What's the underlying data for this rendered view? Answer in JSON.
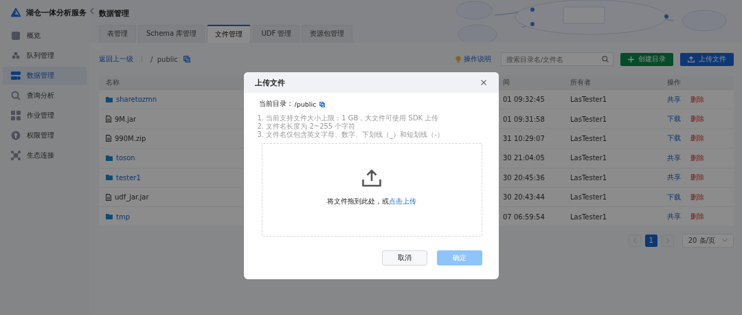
{
  "sidebar": {
    "title": "湖仓一体分析服务",
    "items": [
      {
        "label": "概览",
        "selected": false
      },
      {
        "label": "队列管理",
        "selected": false
      },
      {
        "label": "数据管理",
        "selected": true
      },
      {
        "label": "查询分析",
        "selected": false
      },
      {
        "label": "作业管理",
        "selected": false
      },
      {
        "label": "权限管理",
        "selected": false
      },
      {
        "label": "生态连接",
        "selected": false
      }
    ]
  },
  "page": {
    "title": "数据管理"
  },
  "tabs": [
    {
      "label": "表管理",
      "selected": false
    },
    {
      "label": "Schema 库管理",
      "selected": false
    },
    {
      "label": "文件管理",
      "selected": true
    },
    {
      "label": "UDF 管理",
      "selected": false
    },
    {
      "label": "资源包管理",
      "selected": false
    }
  ],
  "toolbar": {
    "back_link": "返回上一级",
    "path": "/  public",
    "help_link": "操作说明",
    "search_placeholder": "搜索目录名/文件名",
    "create_button": "创建目录",
    "upload_button": "上传文件"
  },
  "table": {
    "columns": [
      "名称",
      "间",
      "所有者",
      "操作"
    ],
    "rows": [
      {
        "name": "sharetozmn",
        "kind": "folder",
        "time": "01 09:32:45",
        "owner": "LasTester1",
        "actions": [
          {
            "label": "共享",
            "kind": "primary"
          },
          {
            "label": "删除",
            "kind": "danger"
          }
        ]
      },
      {
        "name": "9M.jar",
        "kind": "file",
        "time": "01 09:31:58",
        "owner": "LasTester1",
        "actions": [
          {
            "label": "下载",
            "kind": "primary"
          },
          {
            "label": "删除",
            "kind": "danger"
          }
        ]
      },
      {
        "name": "990M.zip",
        "kind": "file",
        "time": "31 10:29:07",
        "owner": "LasTester1",
        "actions": [
          {
            "label": "下载",
            "kind": "primary"
          },
          {
            "label": "删除",
            "kind": "danger"
          }
        ]
      },
      {
        "name": "toson",
        "kind": "folder",
        "time": "30 21:04:05",
        "owner": "LasTester1",
        "actions": [
          {
            "label": "共享",
            "kind": "primary"
          },
          {
            "label": "删除",
            "kind": "danger"
          }
        ]
      },
      {
        "name": "tester1",
        "kind": "folder",
        "time": "30 20:45:36",
        "owner": "LasTester1",
        "actions": [
          {
            "label": "共享",
            "kind": "primary"
          },
          {
            "label": "删除",
            "kind": "danger"
          }
        ]
      },
      {
        "name": "udf_jar.jar",
        "kind": "file",
        "time": "30 20:43:44",
        "owner": "LasTester1",
        "actions": [
          {
            "label": "下载",
            "kind": "primary"
          },
          {
            "label": "删除",
            "kind": "danger"
          }
        ]
      },
      {
        "name": "tmp",
        "kind": "folder",
        "time": "07 06:59:54",
        "owner": "LasTester1",
        "actions": [
          {
            "label": "共享",
            "kind": "primary"
          },
          {
            "label": "删除",
            "kind": "danger"
          }
        ]
      }
    ]
  },
  "pagination": {
    "pages": [
      {
        "label": "1",
        "selected": true
      }
    ],
    "page_size": "20 条/页"
  },
  "dialog": {
    "title": "上传文件",
    "current_dir_label": "当前目录：",
    "current_dir": "/public",
    "notes": [
      "1. 当前支持文件大小上限：1 GB，大文件可使用 SDK 上传",
      "2. 文件名长度为 2~255 个字符",
      "3. 文件名仅包含英文字母、数字、下划线（_）和短划线（-）"
    ],
    "dropzone": {
      "text": "将文件拖到此处，或",
      "link": "点击上传"
    },
    "buttons": [
      {
        "label": "取消",
        "kind": "default",
        "disabled": false
      },
      {
        "label": "确定",
        "kind": "primary",
        "disabled": true
      }
    ]
  }
}
